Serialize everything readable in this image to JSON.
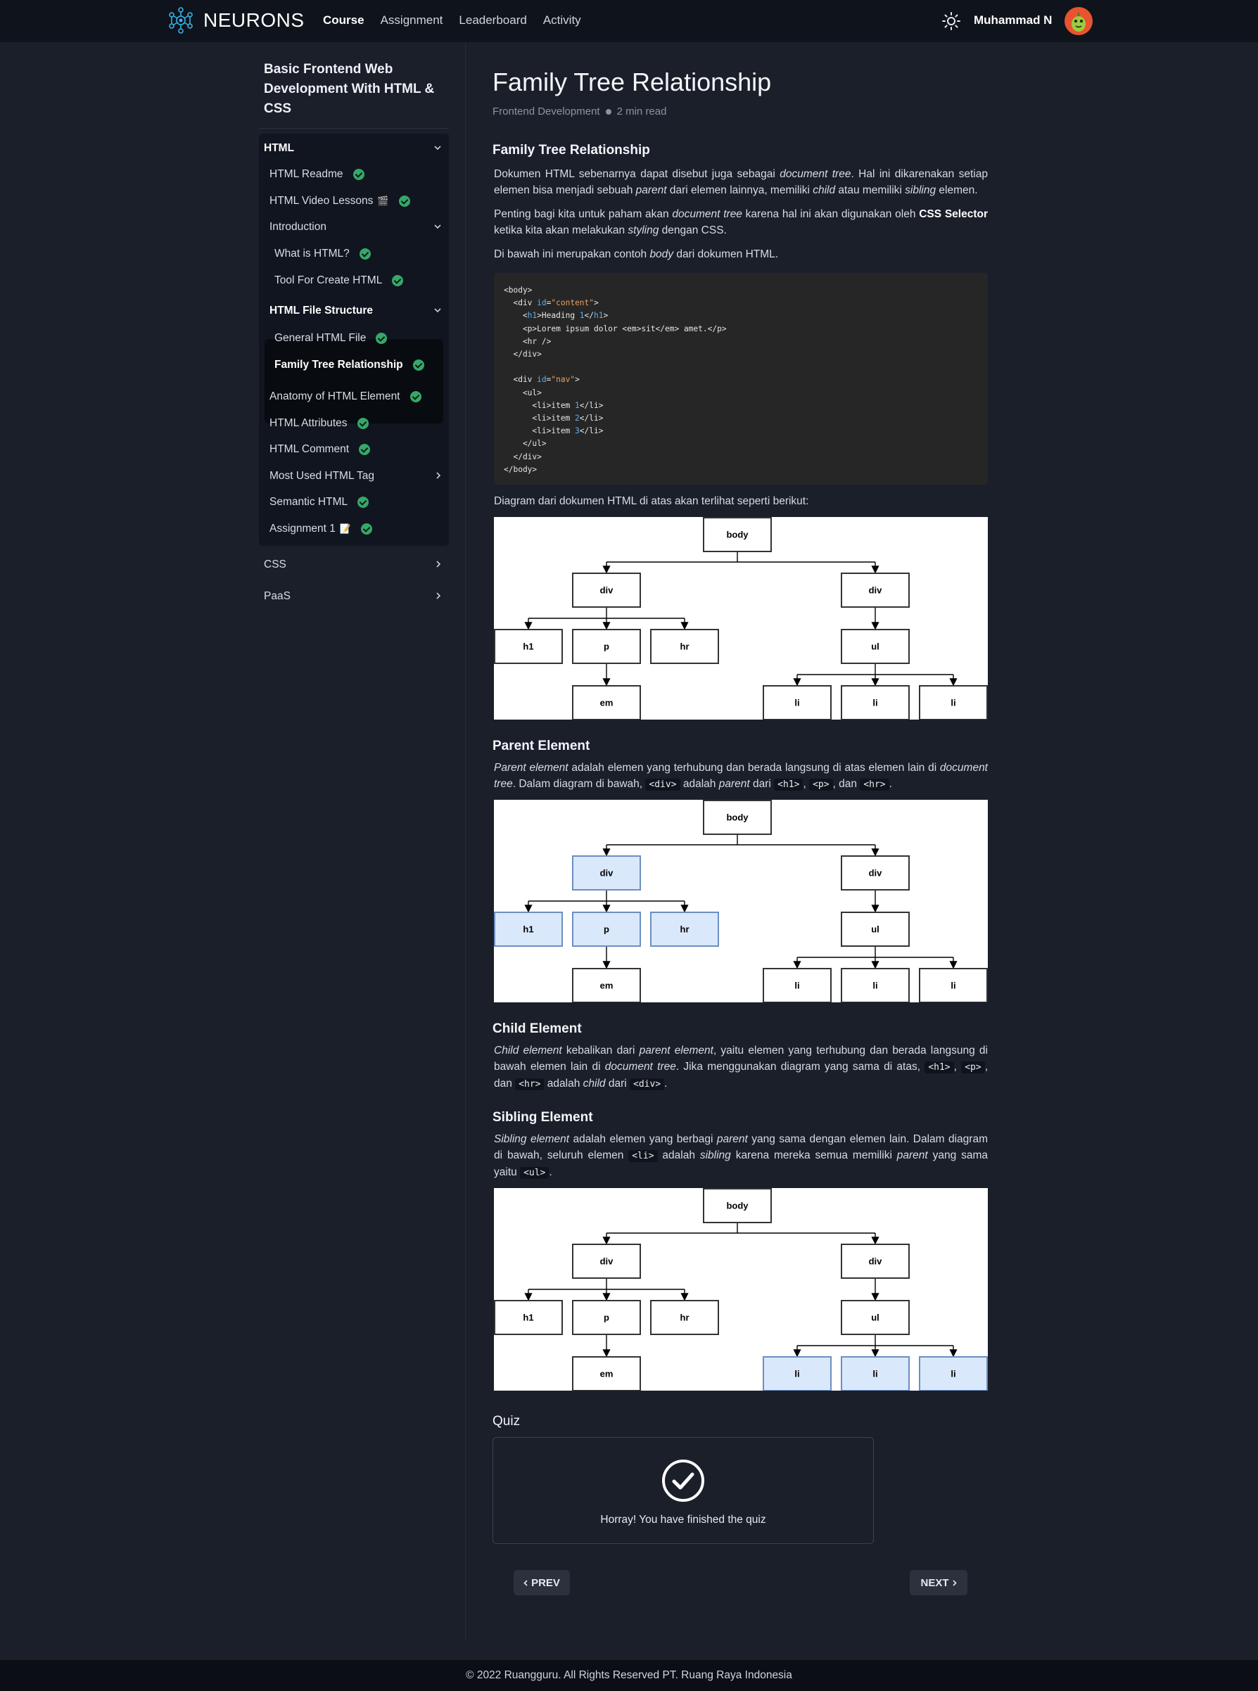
{
  "nav": {
    "brand": "NEURONS",
    "links": [
      "Course",
      "Assignment",
      "Leaderboard",
      "Activity"
    ],
    "active_link": "Course",
    "user_name": "Muhammad N"
  },
  "sidebar": {
    "course_title": "Basic Frontend Web Development With HTML & CSS",
    "sections": [
      "HTML",
      "CSS",
      "PaaS"
    ],
    "html_items": {
      "readme": "HTML Readme",
      "video": "HTML Video Lessons",
      "video_emoji": "🎬",
      "introduction": "Introduction",
      "what_is": "What is HTML?",
      "tool": "Tool For Create HTML",
      "file_structure": "HTML File Structure",
      "general": "General HTML File",
      "family": "Family Tree Relationship",
      "anatomy": "Anatomy of HTML Element",
      "attributes": "HTML Attributes",
      "comment": "HTML Comment",
      "most_used": "Most Used HTML Tag",
      "semantic": "Semantic HTML",
      "assignment": "Assignment 1",
      "assignment_emoji": "📝"
    }
  },
  "article": {
    "title": "Family Tree Relationship",
    "category": "Frontend Development",
    "read_time": "2 min read",
    "sections": {
      "family": "Family Tree Relationship",
      "parent": "Parent Element",
      "child": "Child Element",
      "sibling": "Sibling Element",
      "quiz": "Quiz"
    },
    "code": "<body>\n  <div id=\"content\">\n    <h1>Heading 1</h1>\n    <p>Lorem ipsum dolor <em>sit</em> amet.</p>\n    <hr />\n  </div>\n\n  <div id=\"nav\">\n    <ul>\n      <li>item 1</li>\n      <li>item 2</li>\n      <li>item 3</li>\n    </ul>\n  </div>\n</body>",
    "paragraphs": {
      "p1": "Dokumen HTML sebenarnya dapat disebut juga sebagai document tree. Hal ini dikarenakan setiap elemen bisa menjadi sebuah parent dari elemen lainnya, memiliki child atau memiliki sibling elemen.",
      "p2": "Penting bagi kita untuk paham akan document tree karena hal ini akan digunakan oleh CSS Selector ketika kita akan melakukan styling dengan CSS.",
      "p3": "Di bawah ini merupakan contoh body dari dokumen HTML.",
      "p4": "Diagram dari dokumen HTML di atas akan terlihat seperti berikut:",
      "p5": "Parent element adalah elemen yang terhubung dan berada langsung di atas elemen lain di document tree. Dalam diagram di bawah, <div> adalah parent dari <h1>, <p>, dan <hr>.",
      "p6": "Child element kebalikan dari parent element, yaitu elemen yang terhubung dan berada langsung di bawah elemen lain di document tree. Jika menggunakan diagram yang sama di atas, <h1>, <p>, dan <hr> adalah child dari <div>.",
      "p7": "Sibling element adalah elemen yang berbagi parent yang sama dengan elemen lain. Dalam diagram di bawah, seluruh elemen <li> adalah sibling karena mereka semua memiliki parent yang sama yaitu <ul>."
    },
    "tree_labels": [
      "body",
      "div",
      "div",
      "h1",
      "p",
      "hr",
      "ul",
      "em",
      "li",
      "li",
      "li"
    ],
    "highlight_color": "#dae8fc",
    "quiz_message": "Horray! You have finished the quiz",
    "prev_label": "PREV",
    "next_label": "NEXT"
  },
  "footer": {
    "text": "© 2022 Ruangguru. All Rights Reserved PT. Ruang Raya Indonesia"
  },
  "icons": [
    "neurons-logo-icon",
    "sun-icon",
    "avatar-icon",
    "check-icon",
    "chevron-down-icon",
    "chevron-right-icon",
    "chevron-left-icon",
    "quiz-check-icon"
  ],
  "colors": {
    "background": "#1b1f2a",
    "nav_background": "#0f131b",
    "check_green": "#35a869",
    "avatar_orange": "#e8542f"
  }
}
